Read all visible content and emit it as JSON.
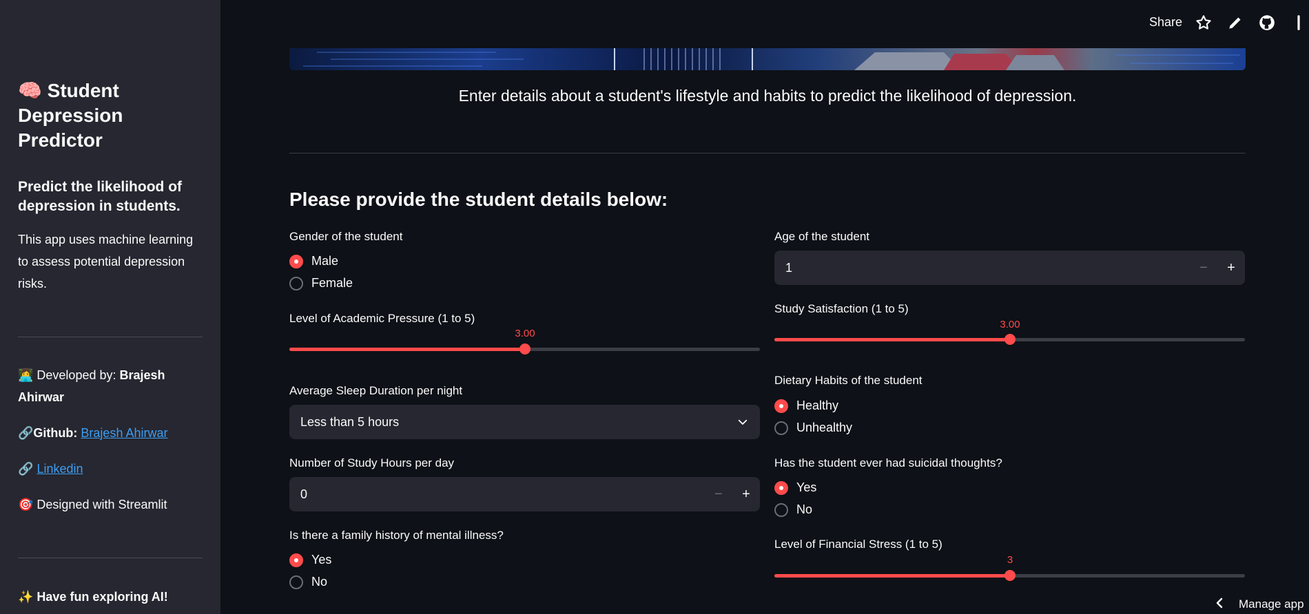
{
  "sidebar": {
    "title": "🧠 Student Depression Predictor",
    "subtitle": "Predict the likelihood of depression in students.",
    "description": "This app uses machine learning to assess potential depression risks.",
    "developed_prefix": "👩‍💻 Developed by:",
    "developer": "Brajesh Ahirwar",
    "github_prefix": "🔗",
    "github_label": "Github:",
    "github_link": "Brajesh Ahirwar",
    "linkedin_prefix": "🔗",
    "linkedin_link": "Linkedin",
    "designed": "🎯 Designed with Streamlit",
    "fun": "✨ Have fun exploring AI!"
  },
  "topbar": {
    "share": "Share",
    "icons": [
      "star-icon",
      "pencil-icon",
      "github-icon",
      "more-icon"
    ]
  },
  "main": {
    "intro": "Enter details about a student's lifestyle and habits to predict the likelihood of depression.",
    "section_heading": "Please provide the student details below:",
    "gender": {
      "label": "Gender of the student",
      "options": [
        "Male",
        "Female"
      ],
      "selected": "Male"
    },
    "age": {
      "label": "Age of the student",
      "value": "1",
      "minus": "−",
      "plus": "+"
    },
    "academic_pressure": {
      "label": "Level of Academic Pressure (1 to 5)",
      "value_text": "3.00",
      "fraction": 0.5
    },
    "study_satisfaction": {
      "label": "Study Satisfaction (1 to 5)",
      "value_text": "3.00",
      "fraction": 0.5
    },
    "sleep": {
      "label": "Average Sleep Duration per night",
      "value": "Less than 5 hours"
    },
    "dietary": {
      "label": "Dietary Habits of the student",
      "options": [
        "Healthy",
        "Unhealthy"
      ],
      "selected": "Healthy"
    },
    "study_hours": {
      "label": "Number of Study Hours per day",
      "value": "0",
      "minus": "−",
      "plus": "+"
    },
    "suicidal": {
      "label": "Has the student ever had suicidal thoughts?",
      "options": [
        "Yes",
        "No"
      ],
      "selected": "Yes"
    },
    "family_history": {
      "label": "Is there a family history of mental illness?",
      "options": [
        "Yes",
        "No"
      ],
      "selected": "Yes"
    },
    "financial_stress": {
      "label": "Level of Financial Stress (1 to 5)",
      "value_text": "3",
      "fraction": 0.5
    }
  },
  "manage_app": "Manage app",
  "colors": {
    "accent": "#ff4b4b",
    "background": "#0e1117",
    "sidebar": "#262730",
    "link": "#3d9df3"
  }
}
